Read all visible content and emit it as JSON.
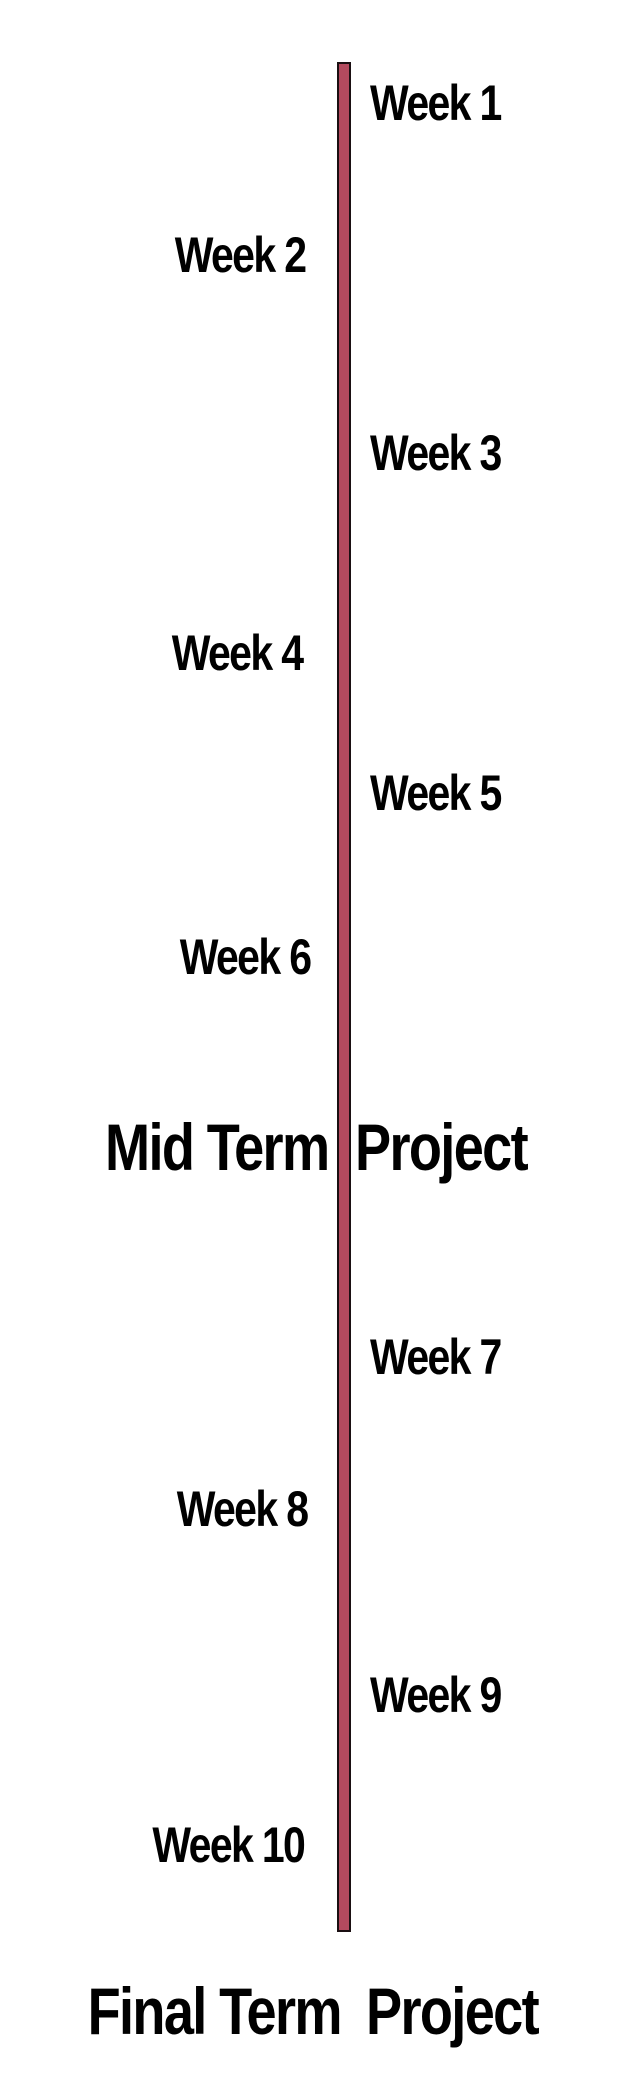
{
  "colors": {
    "timeline_bar": "#b34a5e",
    "text": "#000000",
    "background": "#ffffff"
  },
  "weeks": {
    "w1": "Week 1",
    "w2": "Week 2",
    "w3": "Week 3",
    "w4": "Week 4",
    "w5": "Week 5",
    "w6": "Week 6",
    "w7": "Week 7",
    "w8": "Week 8",
    "w9": "Week 9",
    "w10": "Week 10"
  },
  "milestones": {
    "mid_left": "Mid Term",
    "mid_right": "Project",
    "final_left": "Final Term",
    "final_right": "Project"
  }
}
